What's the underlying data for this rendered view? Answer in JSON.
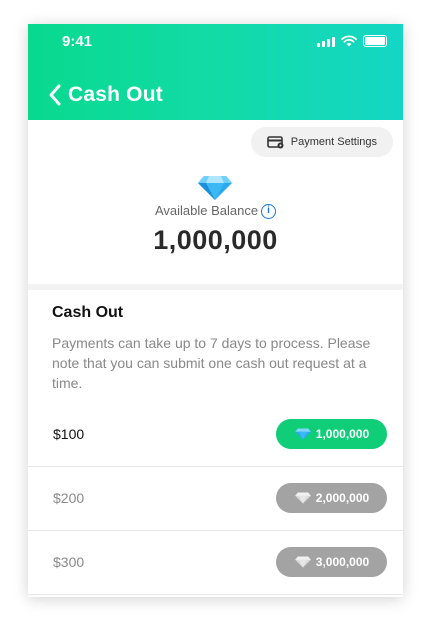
{
  "status": {
    "time": "9:41"
  },
  "header": {
    "title": "Cash Out"
  },
  "payment_settings": {
    "label": "Payment Settings"
  },
  "balance": {
    "label": "Available Balance",
    "value": "1,000,000"
  },
  "cashout": {
    "title": "Cash Out",
    "description": "Payments can take up to 7 days to process. Please note that you can submit one cash out request at a time.",
    "options": [
      {
        "amount": "$100",
        "price": "1,000,000",
        "enabled": true
      },
      {
        "amount": "$200",
        "price": "2,000,000",
        "enabled": false
      },
      {
        "amount": "$300",
        "price": "3,000,000",
        "enabled": false
      }
    ]
  },
  "colors": {
    "header_start": "#08d98f",
    "header_end": "#14d6c6",
    "enabled_button": "#10cd78",
    "disabled_button": "#a3a3a3",
    "info_blue": "#1a78d4"
  }
}
